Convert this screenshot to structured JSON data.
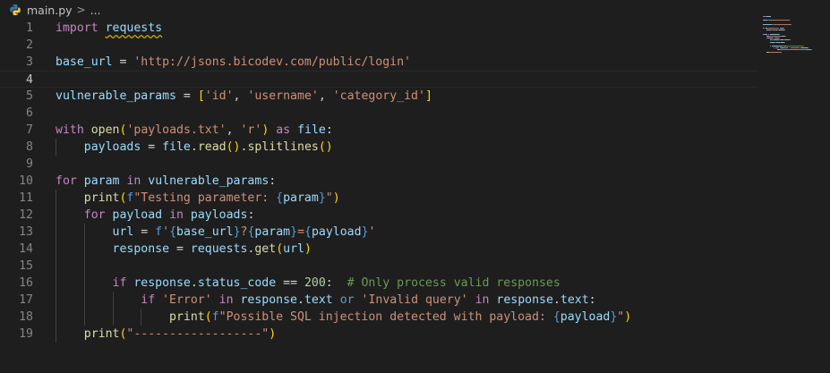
{
  "breadcrumb": {
    "file": "main.py",
    "separator": ">",
    "more": "..."
  },
  "colors": {
    "background": "#1e1e1e",
    "keyword": "#c586c0",
    "variable": "#9cdcfe",
    "function": "#dcdcaa",
    "string": "#ce9178",
    "number": "#b5cea8",
    "comment": "#6a9955"
  },
  "current_line": 4,
  "lines": [
    {
      "n": "1",
      "tokens": [
        [
          "kw",
          "import"
        ],
        [
          "punc",
          " "
        ],
        [
          "var squiggle",
          "requests"
        ]
      ]
    },
    {
      "n": "2",
      "tokens": []
    },
    {
      "n": "3",
      "tokens": [
        [
          "var",
          "base_url"
        ],
        [
          "punc",
          " = "
        ],
        [
          "str",
          "'http://jsons.bicodev.com/public/login'"
        ]
      ]
    },
    {
      "n": "4",
      "tokens": []
    },
    {
      "n": "5",
      "tokens": [
        [
          "var",
          "vulnerable_params"
        ],
        [
          "punc",
          " = "
        ],
        [
          "br1",
          "["
        ],
        [
          "str",
          "'id'"
        ],
        [
          "punc",
          ", "
        ],
        [
          "str",
          "'username'"
        ],
        [
          "punc",
          ", "
        ],
        [
          "str",
          "'category_id'"
        ],
        [
          "br1",
          "]"
        ]
      ]
    },
    {
      "n": "6",
      "tokens": []
    },
    {
      "n": "7",
      "tokens": [
        [
          "kw",
          "with"
        ],
        [
          "punc",
          " "
        ],
        [
          "fn",
          "open"
        ],
        [
          "br1",
          "("
        ],
        [
          "str",
          "'payloads.txt'"
        ],
        [
          "punc",
          ", "
        ],
        [
          "str",
          "'r'"
        ],
        [
          "br1",
          ")"
        ],
        [
          "punc",
          " "
        ],
        [
          "kw",
          "as"
        ],
        [
          "punc",
          " "
        ],
        [
          "var",
          "file"
        ],
        [
          "punc",
          ":"
        ]
      ]
    },
    {
      "n": "8",
      "indent": 1,
      "tokens": [
        [
          "var",
          "payloads"
        ],
        [
          "punc",
          " = "
        ],
        [
          "var",
          "file"
        ],
        [
          "punc",
          "."
        ],
        [
          "fn",
          "read"
        ],
        [
          "br1",
          "()"
        ],
        [
          "punc",
          "."
        ],
        [
          "fn",
          "splitlines"
        ],
        [
          "br1",
          "()"
        ]
      ]
    },
    {
      "n": "9",
      "tokens": []
    },
    {
      "n": "10",
      "tokens": [
        [
          "kw",
          "for"
        ],
        [
          "punc",
          " "
        ],
        [
          "var",
          "param"
        ],
        [
          "punc",
          " "
        ],
        [
          "kw",
          "in"
        ],
        [
          "punc",
          " "
        ],
        [
          "var",
          "vulnerable_params"
        ],
        [
          "punc",
          ":"
        ]
      ]
    },
    {
      "n": "11",
      "indent": 1,
      "tokens": [
        [
          "fn",
          "print"
        ],
        [
          "br1",
          "("
        ],
        [
          "kw2",
          "f"
        ],
        [
          "str",
          "\"Testing parameter: "
        ],
        [
          "interp",
          "{"
        ],
        [
          "var",
          "param"
        ],
        [
          "interp",
          "}"
        ],
        [
          "str",
          "\""
        ],
        [
          "br1",
          ")"
        ]
      ]
    },
    {
      "n": "12",
      "indent": 1,
      "tokens": [
        [
          "kw",
          "for"
        ],
        [
          "punc",
          " "
        ],
        [
          "var",
          "payload"
        ],
        [
          "punc",
          " "
        ],
        [
          "kw",
          "in"
        ],
        [
          "punc",
          " "
        ],
        [
          "var",
          "payloads"
        ],
        [
          "punc",
          ":"
        ]
      ]
    },
    {
      "n": "13",
      "indent": 2,
      "tokens": [
        [
          "var",
          "url"
        ],
        [
          "punc",
          " = "
        ],
        [
          "kw2",
          "f"
        ],
        [
          "str",
          "'"
        ],
        [
          "interp",
          "{"
        ],
        [
          "var",
          "base_url"
        ],
        [
          "interp",
          "}"
        ],
        [
          "str",
          "?"
        ],
        [
          "interp",
          "{"
        ],
        [
          "var",
          "param"
        ],
        [
          "interp",
          "}"
        ],
        [
          "str",
          "="
        ],
        [
          "interp",
          "{"
        ],
        [
          "var",
          "payload"
        ],
        [
          "interp",
          "}"
        ],
        [
          "str",
          "'"
        ]
      ]
    },
    {
      "n": "14",
      "indent": 2,
      "tokens": [
        [
          "var",
          "response"
        ],
        [
          "punc",
          " = "
        ],
        [
          "var",
          "requests"
        ],
        [
          "punc",
          "."
        ],
        [
          "fn",
          "get"
        ],
        [
          "br1",
          "("
        ],
        [
          "var",
          "url"
        ],
        [
          "br1",
          ")"
        ]
      ]
    },
    {
      "n": "15",
      "indent": 2,
      "tokens": []
    },
    {
      "n": "16",
      "indent": 2,
      "tokens": [
        [
          "kw",
          "if"
        ],
        [
          "punc",
          " "
        ],
        [
          "var",
          "response"
        ],
        [
          "punc",
          "."
        ],
        [
          "var",
          "status_code"
        ],
        [
          "punc",
          " == "
        ],
        [
          "num",
          "200"
        ],
        [
          "punc",
          ":  "
        ],
        [
          "cmt",
          "# Only process valid responses"
        ]
      ]
    },
    {
      "n": "17",
      "indent": 3,
      "tokens": [
        [
          "kw",
          "if"
        ],
        [
          "punc",
          " "
        ],
        [
          "str",
          "'Error'"
        ],
        [
          "punc",
          " "
        ],
        [
          "kw",
          "in"
        ],
        [
          "punc",
          " "
        ],
        [
          "var",
          "response"
        ],
        [
          "punc",
          "."
        ],
        [
          "var",
          "text"
        ],
        [
          "punc",
          " "
        ],
        [
          "kw2",
          "or"
        ],
        [
          "punc",
          " "
        ],
        [
          "str",
          "'Invalid query'"
        ],
        [
          "punc",
          " "
        ],
        [
          "kw",
          "in"
        ],
        [
          "punc",
          " "
        ],
        [
          "var",
          "response"
        ],
        [
          "punc",
          "."
        ],
        [
          "var",
          "text"
        ],
        [
          "punc",
          ":"
        ]
      ]
    },
    {
      "n": "18",
      "indent": 4,
      "tokens": [
        [
          "fn",
          "print"
        ],
        [
          "br1",
          "("
        ],
        [
          "kw2",
          "f"
        ],
        [
          "str",
          "\"Possible SQL injection detected with payload: "
        ],
        [
          "interp",
          "{"
        ],
        [
          "var",
          "payload"
        ],
        [
          "interp",
          "}"
        ],
        [
          "str",
          "\""
        ],
        [
          "br1",
          ")"
        ]
      ]
    },
    {
      "n": "19",
      "indent": 1,
      "tokens": [
        [
          "fn",
          "print"
        ],
        [
          "br1",
          "("
        ],
        [
          "str",
          "\"------------------\""
        ],
        [
          "br1",
          ")"
        ]
      ]
    }
  ]
}
